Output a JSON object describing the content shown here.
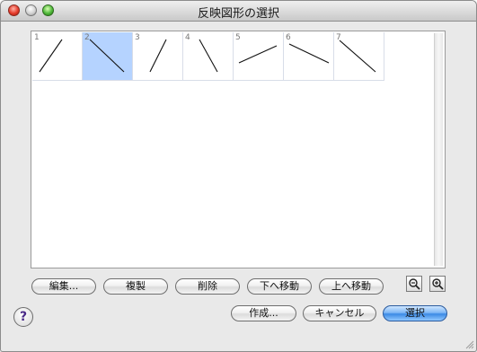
{
  "window": {
    "title": "反映図形の選択"
  },
  "thumbnails": [
    {
      "num": "1",
      "selected": false,
      "line": [
        33,
        8,
        8,
        44
      ]
    },
    {
      "num": "2",
      "selected": true,
      "line": [
        8,
        8,
        46,
        44
      ]
    },
    {
      "num": "3",
      "selected": false,
      "line": [
        37,
        8,
        19,
        44
      ]
    },
    {
      "num": "4",
      "selected": false,
      "line": [
        18,
        8,
        38,
        44
      ]
    },
    {
      "num": "5",
      "selected": false,
      "line": [
        48,
        15,
        6,
        34
      ]
    },
    {
      "num": "6",
      "selected": false,
      "line": [
        6,
        13,
        50,
        34
      ]
    },
    {
      "num": "7",
      "selected": false,
      "line": [
        6,
        9,
        46,
        44
      ]
    }
  ],
  "toolbar": {
    "edit": "編集...",
    "duplicate": "複製",
    "delete": "削除",
    "move_down": "下へ移動",
    "move_up": "上へ移動"
  },
  "footer": {
    "create": "作成...",
    "cancel": "キャンセル",
    "select": "選択",
    "help": "?"
  },
  "icons": {
    "zoom_out": "zoom-out-icon",
    "zoom_in": "zoom-in-icon",
    "help": "help-icon",
    "resize": "resize-grip-icon"
  },
  "colors": {
    "selection": "#b5d3ff",
    "primary_button": "#3c8ae5",
    "close": "#e53b2b",
    "zoom": "#4fb83a"
  }
}
